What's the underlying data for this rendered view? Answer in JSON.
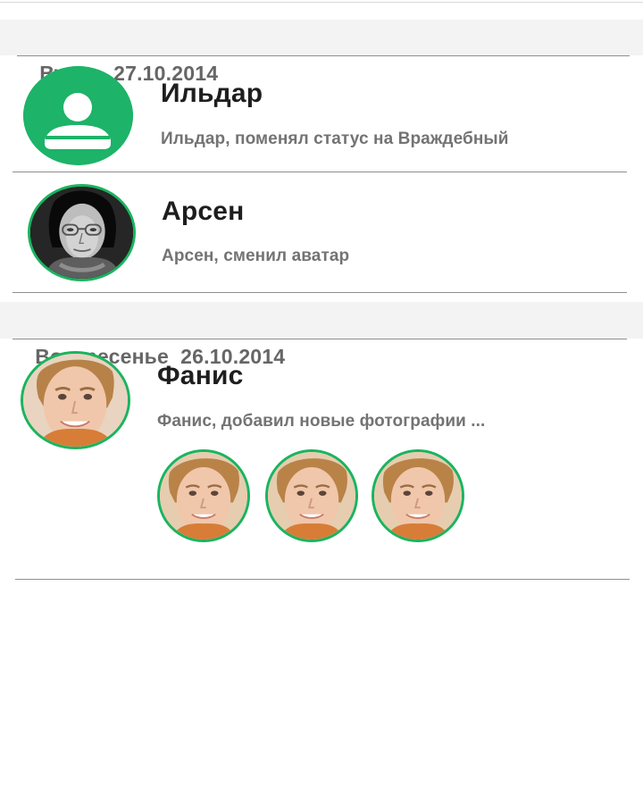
{
  "sections": [
    {
      "label": "Вчера  27.10.2014",
      "items": [
        {
          "name": "Ильдар",
          "message": "Ильдар, поменял статус на Враждебный",
          "avatar": "default-user-icon"
        },
        {
          "name": "Арсен",
          "message": "Арсен, сменил аватар",
          "avatar": "grayscale-portrait-photo"
        }
      ]
    },
    {
      "label": "Воскресенье  26.10.2014",
      "items": [
        {
          "name": "Фанис",
          "message": "Фанис, добавил новые фотографии ...",
          "avatar": "color-portrait-photo",
          "photos": [
            "color-portrait-photo",
            "color-portrait-photo",
            "color-portrait-photo"
          ]
        }
      ]
    }
  ],
  "colors": {
    "accent": "#1ab45f",
    "name_text": "#1e1e1e",
    "secondary_text": "#737373",
    "header_text": "#666666"
  }
}
